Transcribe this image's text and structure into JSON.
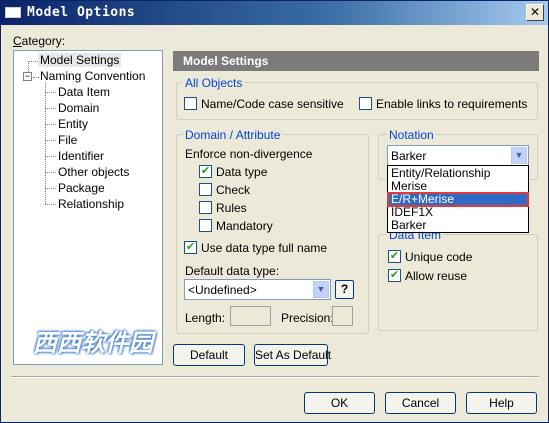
{
  "window": {
    "title": "Model Options",
    "close_glyph": "✕"
  },
  "category_label": "Category:",
  "tree": {
    "root1": "Model Settings",
    "root2": "Naming Convention",
    "expander_glyph": "−",
    "children": [
      "Data Item",
      "Domain",
      "Entity",
      "File",
      "Identifier",
      "Other objects",
      "Package",
      "Relationship"
    ]
  },
  "section_header": "Model Settings",
  "all_objects": {
    "title": "All Objects",
    "name_code_case": "Name/Code case sensitive",
    "enable_links": "Enable links to requirements"
  },
  "domain_attr": {
    "title": "Domain / Attribute",
    "enforce": "Enforce non-divergence",
    "data_type": "Data type",
    "check": "Check",
    "rules": "Rules",
    "mandatory": "Mandatory",
    "use_full_name": "Use data type full name",
    "default_type_label": "Default data type:",
    "default_type_value": "<Undefined>",
    "help_glyph": "?",
    "length_label": "Length:",
    "precision_label": "Precision:"
  },
  "notation": {
    "title": "Notation",
    "selected": "Barker",
    "options": [
      "Entity/Relationship",
      "Merise",
      "E/R+Merise",
      "IDEF1X",
      "Barker"
    ],
    "highlighted_index": 2
  },
  "data_item": {
    "title": "Data Item",
    "unique_code": "Unique code",
    "allow_reuse": "Allow reuse"
  },
  "buttons": {
    "default": "Default",
    "set_as_default": "Set As Default",
    "ok": "OK",
    "cancel": "Cancel",
    "help": "Help"
  },
  "watermark": "西西软件园",
  "colors": {
    "accent": "#0046d5",
    "highlight": "#316ac5",
    "header": "#7b7b7b",
    "highlight_border": "#e03a3a"
  }
}
